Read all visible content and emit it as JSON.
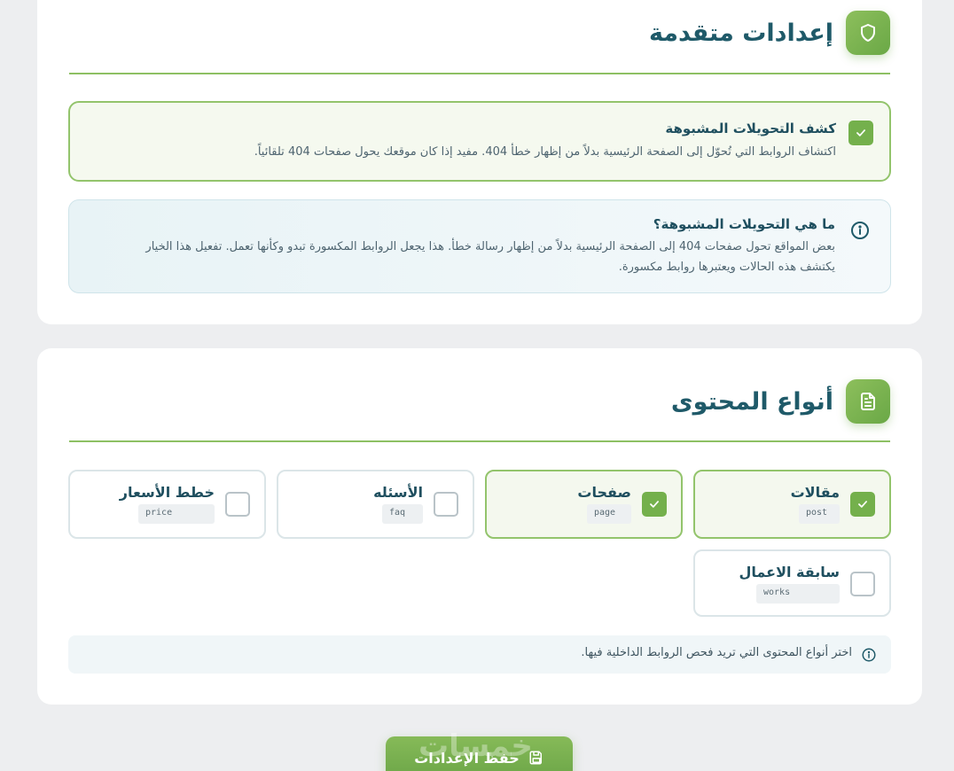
{
  "advanced": {
    "title": "إعدادات متقدمة",
    "option": {
      "title": "كشف التحويلات المشبوهة",
      "description": "اكتشاف الروابط التي تُحوّل إلى الصفحة الرئيسية بدلاً من إظهار خطأ 404. مفيد إذا كان موقعك يحول صفحات 404 تلقائياً.",
      "checked": true
    },
    "info": {
      "title": "ما هي التحويلات المشبوهة؟",
      "line1": "بعض المواقع تحول صفحات 404 إلى الصفحة الرئيسية بدلاً من إظهار رسالة خطأ. هذا يجعل الروابط المكسورة تبدو وكأنها تعمل. تفعيل هذا الخيار",
      "line2": "يكتشف هذه الحالات ويعتبرها روابط مكسورة."
    }
  },
  "content_types": {
    "title": "أنواع المحتوى",
    "items": [
      {
        "label": "مقالات",
        "slug": "post",
        "checked": true
      },
      {
        "label": "صفحات",
        "slug": "page",
        "checked": true
      },
      {
        "label": "الأسئله",
        "slug": "faq",
        "checked": false
      },
      {
        "label": "خطط الأسعار",
        "slug": "price",
        "checked": false
      },
      {
        "label": "سابقة الاعمال",
        "slug": "works",
        "checked": false
      }
    ],
    "note": "اختر أنواع المحتوى التي تريد فحص الروابط الداخلية فيها."
  },
  "save_button": {
    "label": "حفظ الإعدادات"
  },
  "watermark": "خمسات",
  "colors": {
    "accent": "#74b04c",
    "heading": "#1f5a69",
    "background": "#edeef0"
  },
  "icons": {
    "advanced": "shield-icon",
    "content": "document-icon",
    "info": "info-icon",
    "save": "save-icon"
  }
}
